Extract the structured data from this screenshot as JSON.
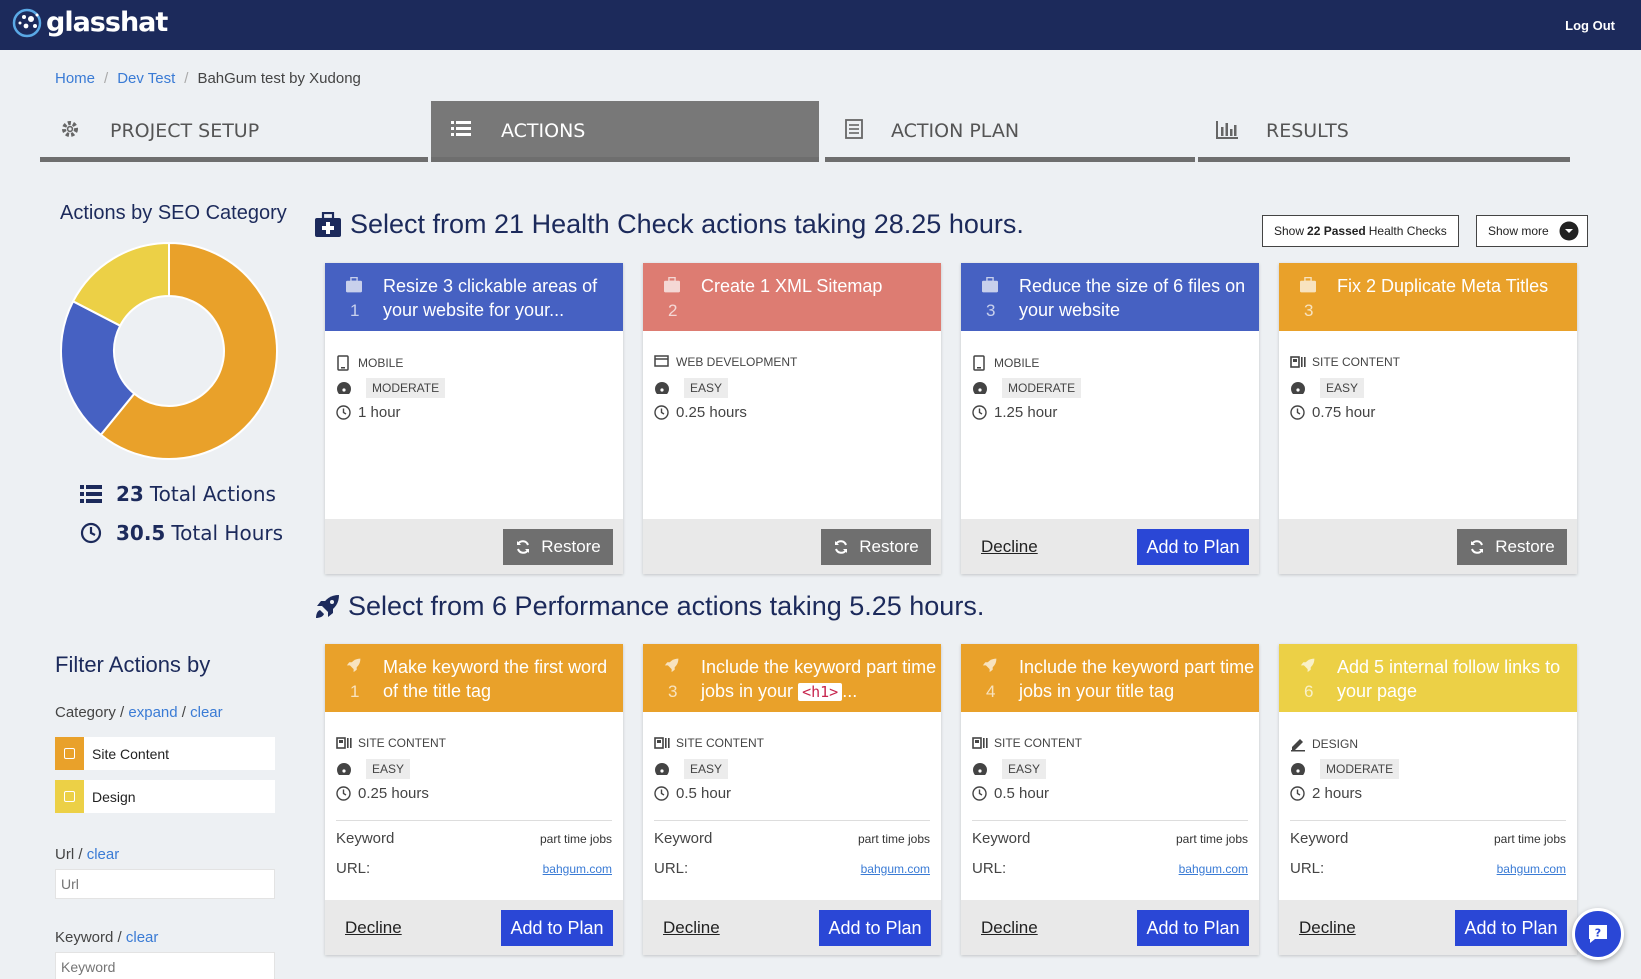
{
  "app": {
    "brand": "glasshat",
    "logout_label": "Log Out"
  },
  "breadcrumb": [
    "Home",
    "Dev Test",
    "BahGum test by Xudong"
  ],
  "tabs": [
    {
      "label": "PROJECT SETUP",
      "icon": "gear-icon",
      "active": false
    },
    {
      "label": "ACTIONS",
      "icon": "list-icon",
      "active": true
    },
    {
      "label": "ACTION PLAN",
      "icon": "document-icon",
      "active": false
    },
    {
      "label": "RESULTS",
      "icon": "bar-chart-icon",
      "active": false
    }
  ],
  "sidebar": {
    "chart_title": "Actions by SEO Category",
    "total_actions": "23",
    "total_actions_label": "Total Actions",
    "total_hours": "30.5",
    "total_hours_label": "Total Hours",
    "filter_title": "Filter Actions by",
    "category_label": "Category",
    "expand_label": "expand",
    "clear_label": "clear",
    "categories": [
      {
        "name": "Site Content",
        "color": "#e9a12a"
      },
      {
        "name": "Design",
        "color": "#ecd046"
      }
    ],
    "url_label": "Url",
    "url_placeholder": "Url",
    "keyword_label": "Keyword",
    "keyword_placeholder": "Keyword"
  },
  "chart_data": {
    "type": "pie",
    "title": "Actions by SEO Category",
    "categories": [
      "Site Content",
      "Mobile",
      "Design"
    ],
    "values": [
      14,
      5,
      4
    ],
    "colors": [
      "#e9a12a",
      "#4661c2",
      "#ecd046"
    ]
  },
  "health": {
    "title": "Select from 21 Health Check actions taking 28.25 hours.",
    "show_passed_prefix": "Show ",
    "show_passed_strong": "22 Passed",
    "show_passed_suffix": " Health Checks",
    "show_more_label": "Show more",
    "cards": [
      {
        "num": "1",
        "title": "Resize 3 clickable areas of your website for your...",
        "color": "#4661c2",
        "category": "MOBILE",
        "cat_icon": "mobile-icon",
        "difficulty": "MODERATE",
        "hours": "1 hour",
        "state": "restore"
      },
      {
        "num": "2",
        "title": "Create 1 XML Sitemap",
        "color": "#dd7c72",
        "category": "WEB DEVELOPMENT",
        "cat_icon": "monitor-icon",
        "difficulty": "EASY",
        "hours": "0.25 hours",
        "state": "restore"
      },
      {
        "num": "3",
        "title": "Reduce the size of 6 files on your website",
        "color": "#4661c2",
        "category": "MOBILE",
        "cat_icon": "mobile-icon",
        "difficulty": "MODERATE",
        "hours": "1.25 hour",
        "state": "open"
      },
      {
        "num": "3",
        "title": "Fix 2 Duplicate Meta Titles",
        "color": "#e9a12a",
        "category": "SITE CONTENT",
        "cat_icon": "content-icon",
        "difficulty": "EASY",
        "hours": "0.75 hour",
        "state": "restore"
      }
    ]
  },
  "performance": {
    "title": "Select from 6 Performance actions taking 5.25 hours.",
    "cards": [
      {
        "num": "1",
        "title_a": "Make keyword the first word of the title tag",
        "title_code": "",
        "title_b": "",
        "color": "#e9a12a",
        "category": "SITE CONTENT",
        "cat_icon": "content-icon",
        "difficulty": "EASY",
        "hours": "0.25 hours",
        "keyword": "part time jobs",
        "url": "bahgum.com"
      },
      {
        "num": "3",
        "title_a": "Include the keyword part time jobs in your ",
        "title_code": "<h1>",
        "title_b": "...",
        "color": "#e9a12a",
        "category": "SITE CONTENT",
        "cat_icon": "content-icon",
        "difficulty": "EASY",
        "hours": "0.5 hour",
        "keyword": "part time jobs",
        "url": "bahgum.com"
      },
      {
        "num": "4",
        "title_a": "Include the keyword part time jobs in your title tag",
        "title_code": "",
        "title_b": "",
        "color": "#e9a12a",
        "category": "SITE CONTENT",
        "cat_icon": "content-icon",
        "difficulty": "EASY",
        "hours": "0.5 hour",
        "keyword": "part time jobs",
        "url": "bahgum.com"
      },
      {
        "num": "6",
        "title_a": "Add 5 internal follow links to your page",
        "title_code": "",
        "title_b": "",
        "color": "#ecd046",
        "category": "DESIGN",
        "cat_icon": "pencil-icon",
        "difficulty": "MODERATE",
        "hours": "2 hours",
        "keyword": "part time jobs",
        "url": "bahgum.com"
      }
    ]
  },
  "labels": {
    "restore": "Restore",
    "add_to_plan": "Add to Plan",
    "decline": "Decline",
    "keyword": "Keyword",
    "url": "URL:"
  }
}
